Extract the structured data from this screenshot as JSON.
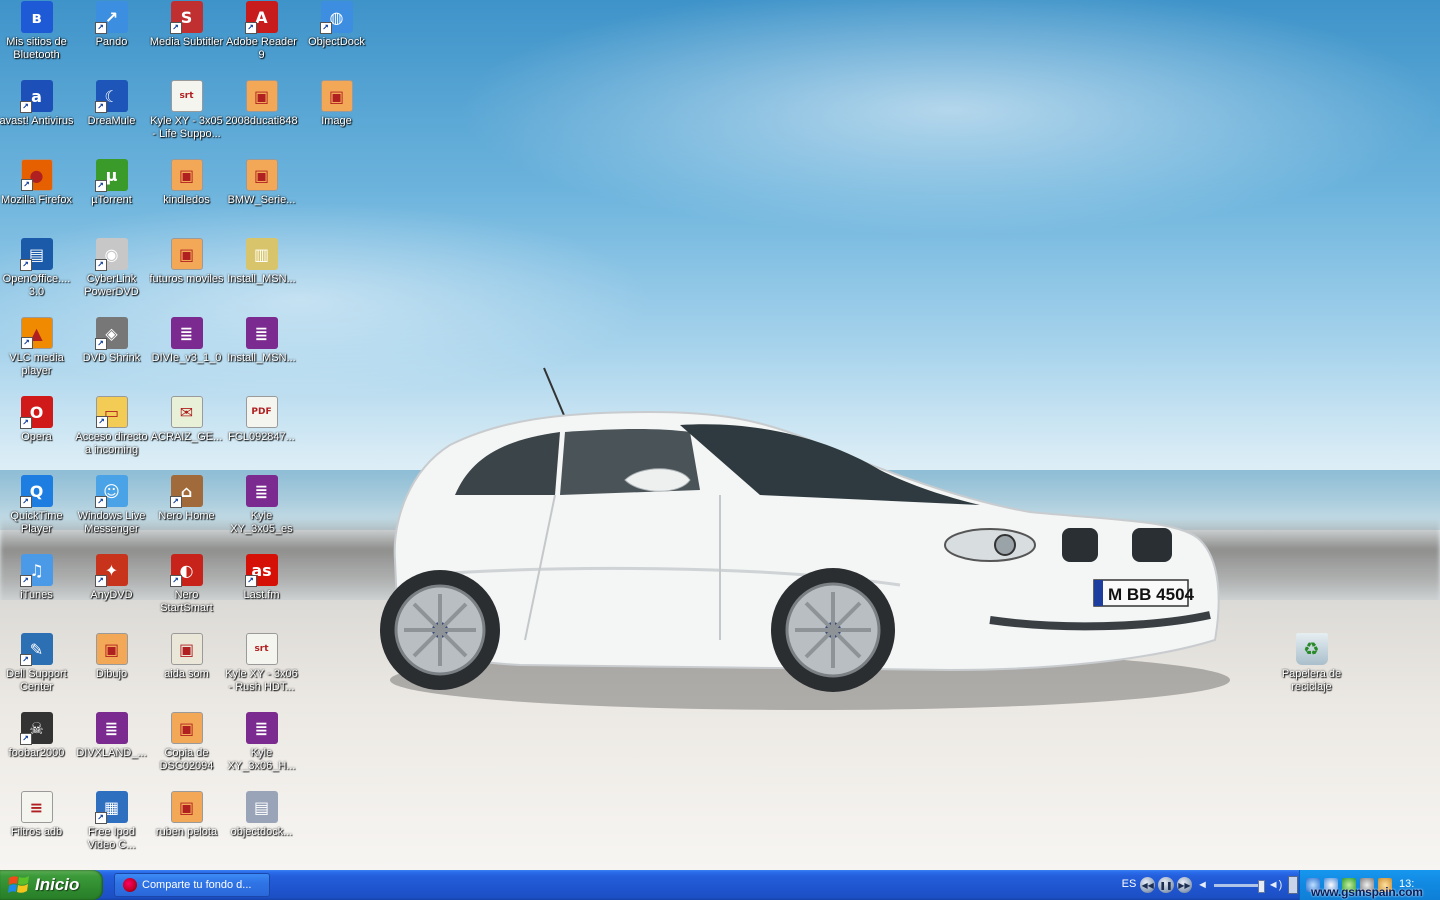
{
  "desktop": {
    "icons": [
      {
        "label": "Mis sitios de Bluetooth",
        "icon": "bluetooth-icon",
        "shortcut": false,
        "color": "#1f5ad6",
        "glyph": "ʙ"
      },
      {
        "label": "avast! Antivirus",
        "icon": "avast-icon",
        "shortcut": true,
        "color": "#1c4fb8",
        "glyph": "a"
      },
      {
        "label": "Mozilla Firefox",
        "icon": "firefox-icon",
        "shortcut": true,
        "color": "#e66000",
        "glyph": "●"
      },
      {
        "label": "OpenOffice.... 3.0",
        "icon": "openoffice-icon",
        "shortcut": true,
        "color": "#1b5aa8",
        "glyph": "▤"
      },
      {
        "label": "VLC media player",
        "icon": "vlc-icon",
        "shortcut": true,
        "color": "#f08a00",
        "glyph": "▲"
      },
      {
        "label": "Opera",
        "icon": "opera-icon",
        "shortcut": true,
        "color": "#d01919",
        "glyph": "O"
      },
      {
        "label": "QuickTime Player",
        "icon": "quicktime-icon",
        "shortcut": true,
        "color": "#1e7de0",
        "glyph": "Q"
      },
      {
        "label": "iTunes",
        "icon": "itunes-icon",
        "shortcut": true,
        "color": "#4b9ae8",
        "glyph": "♫"
      },
      {
        "label": "Dell Support Center",
        "icon": "dell-support-icon",
        "shortcut": true,
        "color": "#2d6fb3",
        "glyph": "✎"
      },
      {
        "label": "foobar2000",
        "icon": "foobar-icon",
        "shortcut": true,
        "color": "#333333",
        "glyph": "☠"
      },
      {
        "label": "Filtros adb",
        "icon": "text-file-icon",
        "shortcut": false,
        "color": "#f5f5f0",
        "glyph": "≡"
      },
      {
        "label": "Pando",
        "icon": "pando-icon",
        "shortcut": true,
        "color": "#3c8ee0",
        "glyph": "↗"
      },
      {
        "label": "DreaMule",
        "icon": "dreamule-icon",
        "shortcut": true,
        "color": "#1d55b8",
        "glyph": "☾"
      },
      {
        "label": "µTorrent",
        "icon": "utorrent-icon",
        "shortcut": true,
        "color": "#3a9a2a",
        "glyph": "µ"
      },
      {
        "label": "CyberLink PowerDVD",
        "icon": "powerdvd-icon",
        "shortcut": true,
        "color": "#c7c7c7",
        "glyph": "◉"
      },
      {
        "label": "DVD Shrink",
        "icon": "dvdshrink-icon",
        "shortcut": true,
        "color": "#777777",
        "glyph": "◈"
      },
      {
        "label": "Acceso directo a incoming",
        "icon": "folder-icon",
        "shortcut": true,
        "color": "#f2cc55",
        "glyph": "▭"
      },
      {
        "label": "Windows Live Messenger",
        "icon": "messenger-icon",
        "shortcut": true,
        "color": "#4aa3e6",
        "glyph": "☺"
      },
      {
        "label": "AnyDVD",
        "icon": "anydvd-icon",
        "shortcut": true,
        "color": "#c8331b",
        "glyph": "✦"
      },
      {
        "label": "Dibujo",
        "icon": "image-file-icon",
        "shortcut": false,
        "color": "#f3a857",
        "glyph": "▣"
      },
      {
        "label": "DIVXLAND_...",
        "icon": "winrar-icon",
        "shortcut": false,
        "color": "#7b2a8f",
        "glyph": "≣"
      },
      {
        "label": "Free Ipod Video C...",
        "icon": "ipod-video-icon",
        "shortcut": true,
        "color": "#2e6fc0",
        "glyph": "▦"
      },
      {
        "label": "Media Subtitler",
        "icon": "media-subtitler-icon",
        "shortcut": true,
        "color": "#c03030",
        "glyph": "S"
      },
      {
        "label": "Kyle XY - 3x05 - Life Suppo...",
        "icon": "subtitle-file-icon",
        "shortcut": false,
        "color": "#f5f5f0",
        "glyph": "srt"
      },
      {
        "label": "kindledos",
        "icon": "image-file-icon",
        "shortcut": false,
        "color": "#f3a857",
        "glyph": "▣"
      },
      {
        "label": "futuros moviles",
        "icon": "image-file-icon",
        "shortcut": false,
        "color": "#f3a857",
        "glyph": "▣"
      },
      {
        "label": "DIVIe_v3_1_0",
        "icon": "winrar-icon",
        "shortcut": false,
        "color": "#7b2a8f",
        "glyph": "≣"
      },
      {
        "label": "ACRAIZ_GE...",
        "icon": "certificate-icon",
        "shortcut": false,
        "color": "#e8f0d8",
        "glyph": "✉"
      },
      {
        "label": "Nero Home",
        "icon": "nero-home-icon",
        "shortcut": true,
        "color": "#a06a3a",
        "glyph": "⌂"
      },
      {
        "label": "Nero StartSmart",
        "icon": "nero-icon",
        "shortcut": true,
        "color": "#c8231b",
        "glyph": "◐"
      },
      {
        "label": "aida som",
        "icon": "image-file-icon",
        "shortcut": false,
        "color": "#eae6d8",
        "glyph": "▣"
      },
      {
        "label": "Copia de DSC02094",
        "icon": "image-file-icon",
        "shortcut": false,
        "color": "#f3a857",
        "glyph": "▣"
      },
      {
        "label": "ruben pelota",
        "icon": "image-file-icon",
        "shortcut": false,
        "color": "#f3a857",
        "glyph": "▣"
      },
      {
        "label": "Adobe Reader 9",
        "icon": "adobe-reader-icon",
        "shortcut": true,
        "color": "#c81b1b",
        "glyph": "A"
      },
      {
        "label": "2008ducati848",
        "icon": "image-file-icon",
        "shortcut": false,
        "color": "#f3a857",
        "glyph": "▣"
      },
      {
        "label": "BMW_Serie...",
        "icon": "image-file-icon",
        "shortcut": false,
        "color": "#f3a857",
        "glyph": "▣"
      },
      {
        "label": "Install_MSN...",
        "icon": "installer-icon",
        "shortcut": false,
        "color": "#d8c46a",
        "glyph": "▥"
      },
      {
        "label": "Install_MSN...",
        "icon": "winrar-icon",
        "shortcut": false,
        "color": "#7b2a8f",
        "glyph": "≣"
      },
      {
        "label": "FCL092847...",
        "icon": "pdf-file-icon",
        "shortcut": false,
        "color": "#f5f5f0",
        "glyph": "PDF"
      },
      {
        "label": "Kyle XY_3x05_es",
        "icon": "winrar-icon",
        "shortcut": false,
        "color": "#7b2a8f",
        "glyph": "≣"
      },
      {
        "label": "Last.fm",
        "icon": "lastfm-icon",
        "shortcut": true,
        "color": "#d51007",
        "glyph": "as"
      },
      {
        "label": "Kyle XY - 3x06 - Rush HDT...",
        "icon": "subtitle-file-icon",
        "shortcut": false,
        "color": "#f5f5f0",
        "glyph": "srt"
      },
      {
        "label": "Kyle XY_3x06_H...",
        "icon": "winrar-icon",
        "shortcut": false,
        "color": "#7b2a8f",
        "glyph": "≣"
      },
      {
        "label": "objectdock...",
        "icon": "objectdock-setup-icon",
        "shortcut": false,
        "color": "#9aa4b8",
        "glyph": "▤"
      },
      {
        "label": "ObjectDock",
        "icon": "objectdock-icon",
        "shortcut": true,
        "color": "#3d8ee0",
        "glyph": "◍"
      },
      {
        "label": "Image",
        "icon": "image-file-icon",
        "shortcut": false,
        "color": "#f3a857",
        "glyph": "▣"
      }
    ],
    "recycle_bin": {
      "label": "Papelera de reciclaje",
      "icon": "recycle-bin-icon"
    },
    "license_plate": "M BB 4504"
  },
  "taskbar": {
    "start_label": "Inicio",
    "task_button": {
      "label": "Comparte tu fondo d...",
      "icon": "opera-task-icon"
    },
    "language": "ES",
    "media_controls": [
      "previous-icon",
      "pause-icon",
      "next-icon",
      "volume-icon"
    ],
    "clock": "13:"
  },
  "watermark": "www.gsmspain.com"
}
